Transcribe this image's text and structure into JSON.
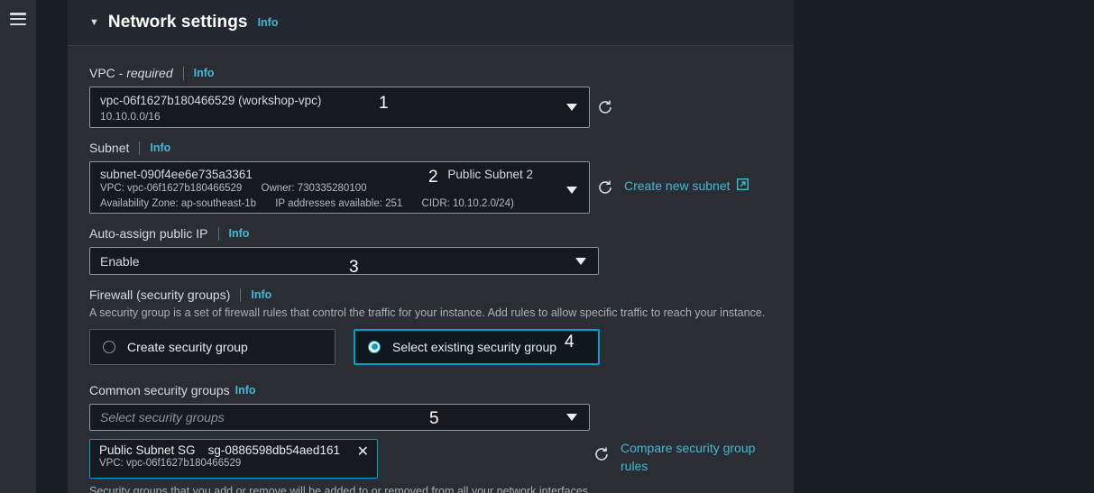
{
  "rail": {
    "menu_icon": "hamburger-menu-icon"
  },
  "panel": {
    "title": "Network settings",
    "info_label": "Info",
    "collapse_caret": "▼"
  },
  "vpc": {
    "label": "VPC -",
    "label_required": "required",
    "info_label": "Info",
    "value_id": "vpc-06f1627b180466529 (workshop-vpc)",
    "value_cidr": "10.10.0.0/16",
    "refresh_icon": "refresh-icon",
    "marker": "1"
  },
  "subnet": {
    "label": "Subnet",
    "info_label": "Info",
    "value_id": "subnet-090f4ee6e735a3361",
    "alias": "Public Subnet 2",
    "meta_vpc": "VPC: vpc-06f1627b180466529",
    "meta_owner": "Owner: 730335280100",
    "meta_az": "Availability Zone: ap-southeast-1b",
    "meta_ips": "IP addresses available: 251",
    "meta_cidr": "CIDR: 10.10.2.0/24)",
    "refresh_icon": "refresh-icon",
    "create_link": "Create new subnet",
    "create_link_icon": "external-link-icon",
    "marker": "2"
  },
  "auto_assign_ip": {
    "label": "Auto-assign public IP",
    "info_label": "Info",
    "value": "Enable",
    "marker": "3"
  },
  "firewall": {
    "label": "Firewall (security groups)",
    "info_label": "Info",
    "description": "A security group is a set of firewall rules that control the traffic for your instance. Add rules to allow specific traffic to reach your instance.",
    "options": [
      {
        "label": "Create security group",
        "selected": false
      },
      {
        "label": "Select existing security group",
        "selected": true
      }
    ],
    "marker": "4"
  },
  "common_security_groups": {
    "label": "Common security groups",
    "info_label": "Info",
    "placeholder": "Select security groups",
    "marker": "5",
    "token": {
      "name": "Public Subnet SG",
      "id": "sg-0886598db54aed161",
      "vpc": "VPC: vpc-06f1627b180466529",
      "remove_icon": "close-icon",
      "remove_glyph": "✕"
    },
    "refresh_icon": "refresh-icon",
    "compare_link": "Compare security group rules",
    "clipped_note": "Security groups that you add or remove will be added to or removed from all your network interfaces."
  },
  "colors": {
    "accent_cyan": "#00a1c9",
    "link_blue": "#44b9d6",
    "panel_bg": "#2a2e34",
    "header_bg": "#232730",
    "input_bg": "#16191f",
    "page_bg": "#191d24",
    "text_primary": "#d5dbdb"
  }
}
